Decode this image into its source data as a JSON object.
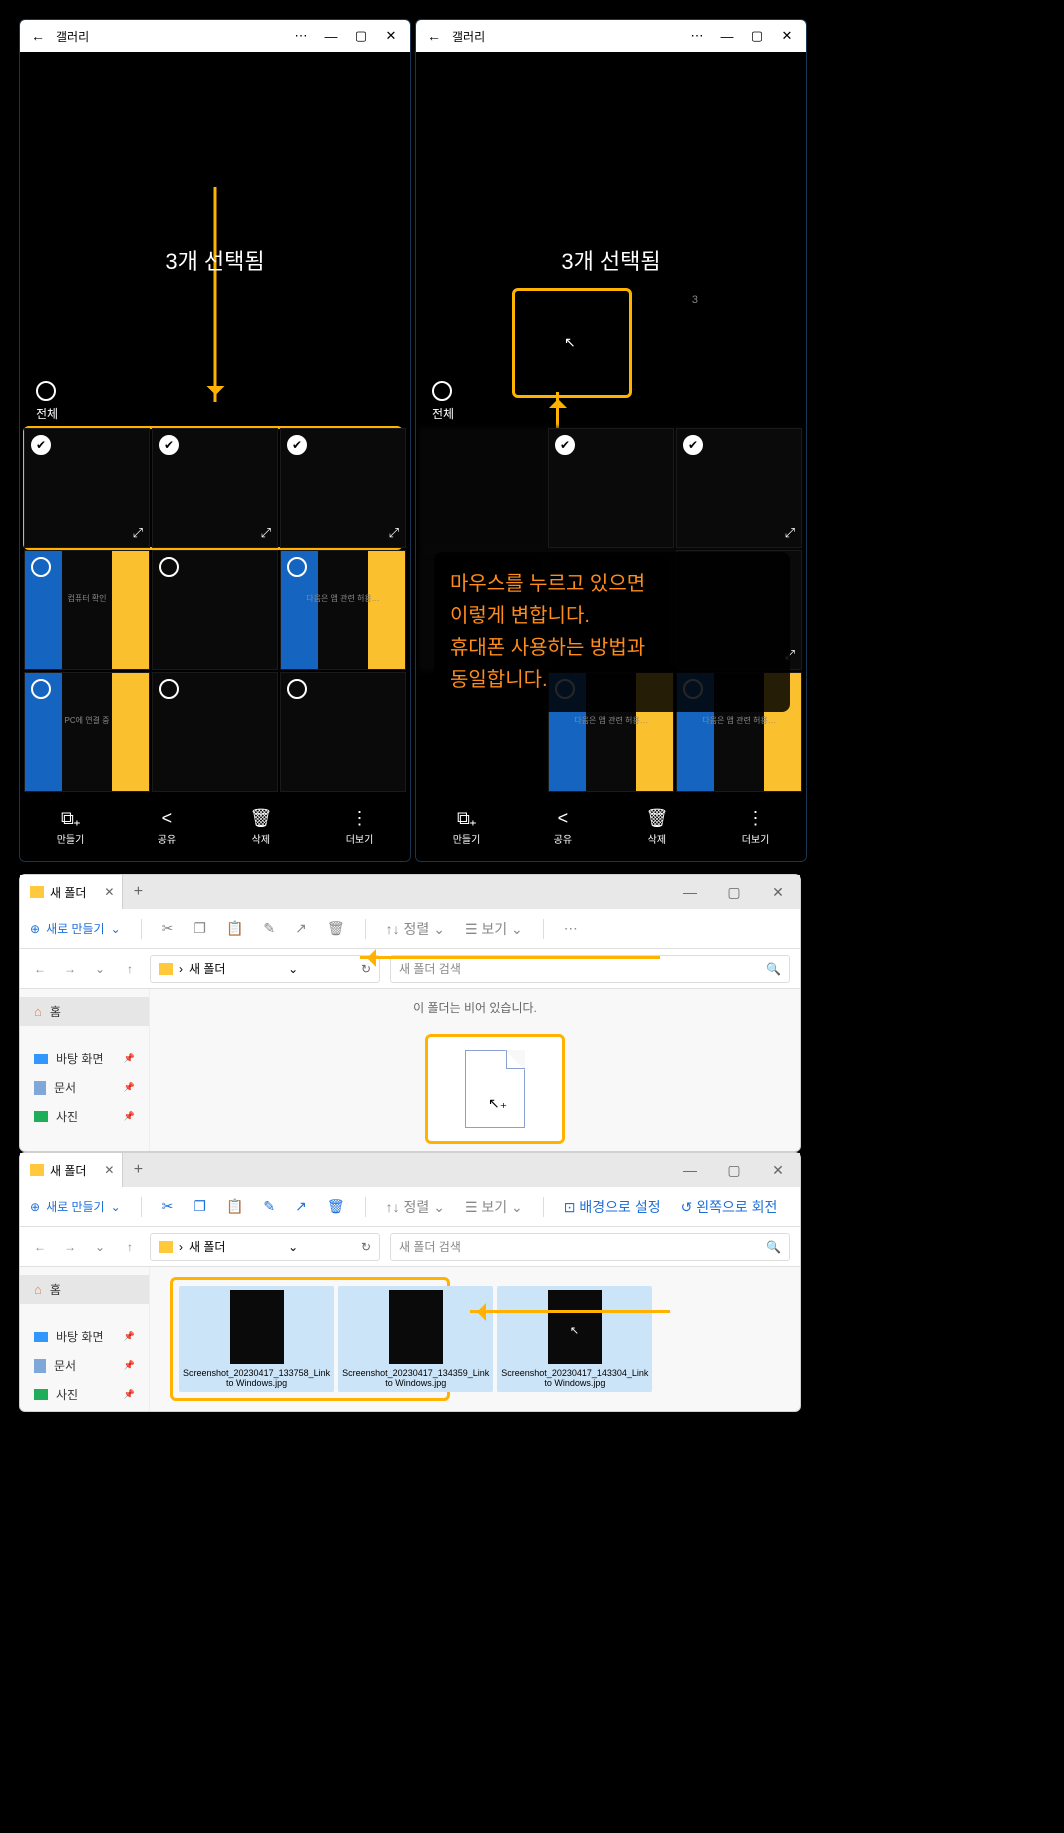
{
  "gallery": {
    "title": "갤러리",
    "selected_text": "3개 선택됨",
    "select_all_label": "전체",
    "drag_count": "3",
    "bottom": {
      "create": "만들기",
      "share": "공유",
      "delete": "삭제",
      "more": "더보기"
    }
  },
  "tip": {
    "line1": "마우스를 누르고 있으면",
    "line2": "이렇게 변합니다.",
    "line3": "휴대폰 사용하는 방법과",
    "line4": "동일합니다."
  },
  "explorer": {
    "tab_title": "새 폴더",
    "new_button": "새로 만들기",
    "sort": "정렬",
    "view": "보기",
    "set_background": "배경으로 설정",
    "rotate_right": "왼쪽으로 회전",
    "breadcrumb": "새 폴더",
    "search_placeholder": "새 폴더 검색",
    "empty_message": "이 폴더는 비어 있습니다.",
    "sidebar": {
      "home": "홈",
      "desktop": "바탕 화면",
      "documents": "문서",
      "pictures": "사진"
    },
    "files": {
      "f1": "Screenshot_20230417_133758_Link to Windows.jpg",
      "f2": "Screenshot_20230417_134359_Link to Windows.jpg",
      "f3": "Screenshot_20230417_143304_Link to Windows.jpg"
    }
  }
}
